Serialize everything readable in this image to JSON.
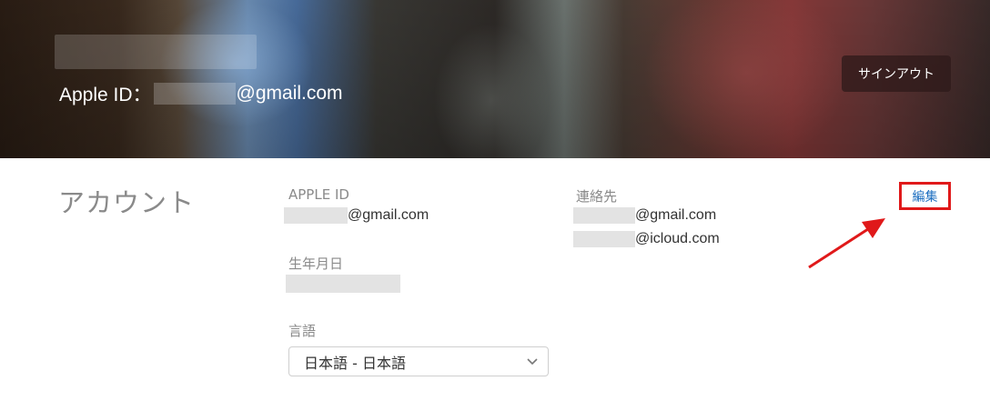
{
  "header": {
    "apple_id_label": "Apple ID：",
    "apple_id_email_suffix": "@gmail.com",
    "signout_label": "サインアウト"
  },
  "account": {
    "section_title": "アカウント",
    "apple_id_label": "APPLE ID",
    "apple_id_suffix": "@gmail.com",
    "birthday_label": "生年月日",
    "language_label": "言語",
    "language_value": "日本語 - 日本語",
    "contact_label": "連絡先",
    "contacts": [
      "@gmail.com",
      "@icloud.com"
    ],
    "edit_label": "編集"
  },
  "colors": {
    "edit_link": "#1e6fc0",
    "highlight_box": "#e0191a",
    "annotation_arrow": "#e0191a"
  },
  "icons": {
    "select_chevron": "chevron-down-icon",
    "annotation_arrow": "arrow-icon"
  }
}
